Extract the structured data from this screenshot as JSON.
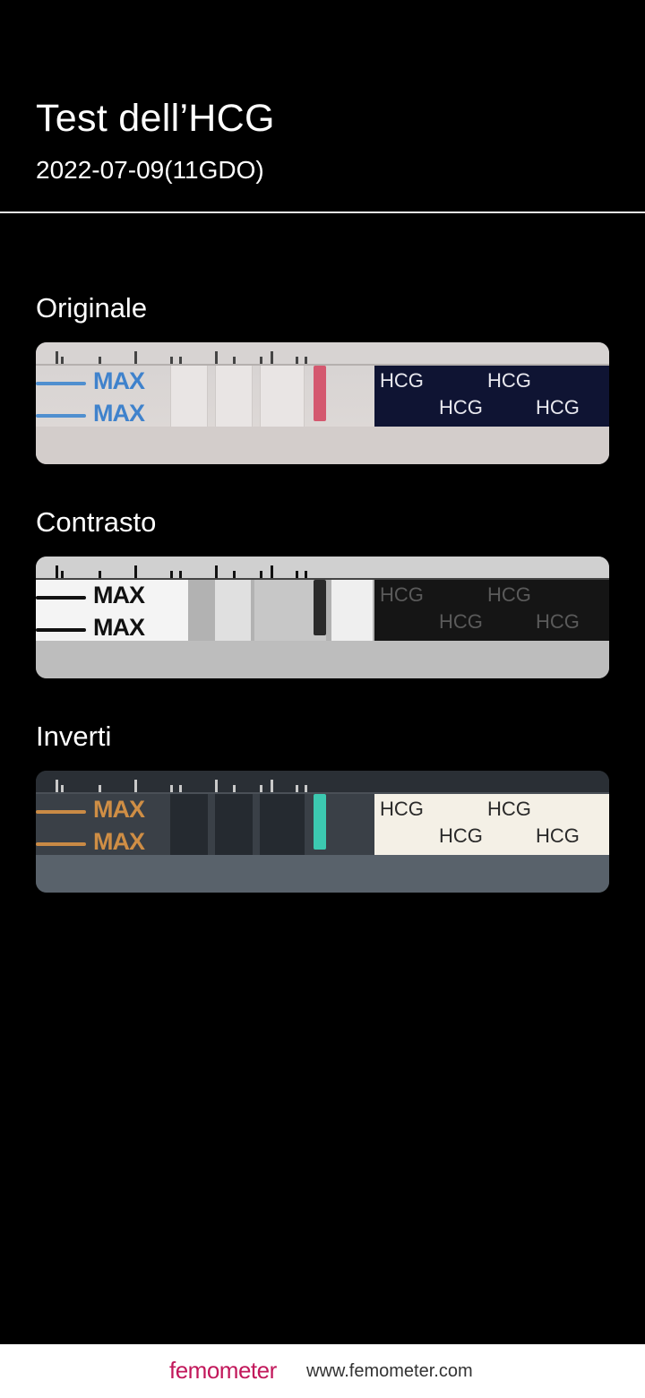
{
  "header": {
    "title": "Test dell’HCG",
    "subtitle": "2022-07-09(11GDO)"
  },
  "sections": [
    {
      "label": "Originale"
    },
    {
      "label": "Contrasto"
    },
    {
      "label": "Inverti"
    }
  ],
  "strip_text": {
    "max": "MAX",
    "hcg": "HCG"
  },
  "footer": {
    "brand": "femometer",
    "website": "www.femometer.com"
  },
  "colors": {
    "brand": "#c2185b",
    "test_line_original": "#d4586f",
    "test_line_inverted": "#3cc9b0"
  }
}
